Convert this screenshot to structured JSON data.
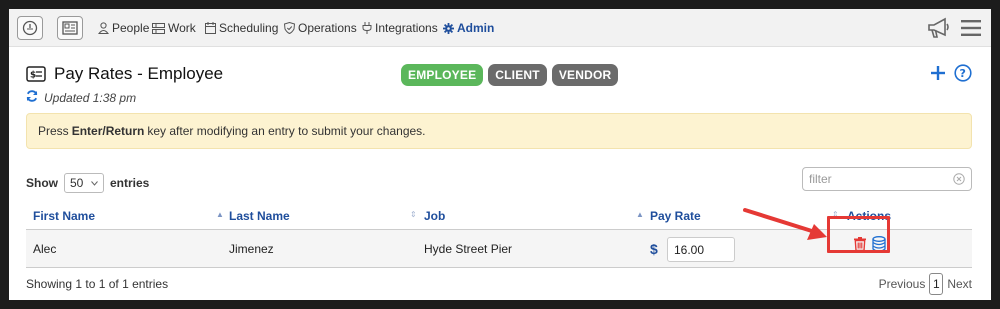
{
  "nav": {
    "items": [
      {
        "label": "People",
        "icon": "person-icon"
      },
      {
        "label": "Work",
        "icon": "work-icon"
      },
      {
        "label": "Scheduling",
        "icon": "calendar-icon"
      },
      {
        "label": "Operations",
        "icon": "shield-icon"
      },
      {
        "label": "Integrations",
        "icon": "plug-icon"
      },
      {
        "label": "Admin",
        "icon": "gear-icon"
      }
    ]
  },
  "page": {
    "title": "Pay Rates - Employee",
    "updated": "Updated 1:38 pm"
  },
  "filters": {
    "employee": "EMPLOYEE",
    "client": "CLIENT",
    "vendor": "VENDOR"
  },
  "alert": {
    "prefix": "Press",
    "key": "Enter/Return",
    "suffix": "key after modifying an entry to submit your changes."
  },
  "table_controls": {
    "show": "Show",
    "page_size": "50",
    "entries": "entries",
    "filter_placeholder": "filter"
  },
  "table": {
    "columns": [
      "First Name",
      "Last Name",
      "Job",
      "Pay Rate",
      "Actions"
    ],
    "rows": [
      {
        "first_name": "Alec",
        "last_name": "Jimenez",
        "job": "Hyde Street Pier",
        "currency": "$",
        "pay_rate": "16.00"
      }
    ]
  },
  "footer": {
    "info": "Showing 1 to 1 of 1 entries",
    "previous": "Previous",
    "page": "1",
    "next": "Next"
  },
  "colors": {
    "accent": "#1f4e9c",
    "employee_pill": "#5bb75b",
    "inactive_pill": "#6b6b6b",
    "alert_bg": "#fdf3d1",
    "delete": "#e53935",
    "annotation": "#e53935"
  }
}
